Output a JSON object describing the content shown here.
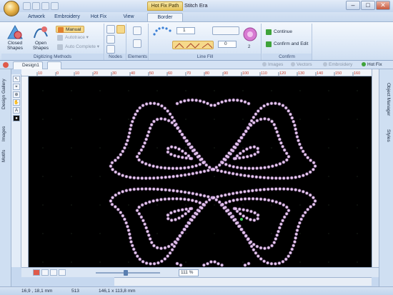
{
  "window": {
    "title": "Stitch Era",
    "context_tab_title": "Hot Fix Path",
    "controls": {
      "minimize": "–",
      "maximize": "□",
      "close": "✕"
    }
  },
  "ribbon_tabs": [
    {
      "label": "Artwork"
    },
    {
      "label": "Embroidery"
    },
    {
      "label": "Hot Fix"
    },
    {
      "label": "View"
    },
    {
      "label": "Border",
      "active": true
    }
  ],
  "groups": {
    "digitizing": {
      "label": "Digitizing Methods",
      "closed_shapes": "Closed\nShapes",
      "open_shapes": "Open\nShapes",
      "manual": "Manual",
      "autotrace": "Autotrace",
      "auto_complete": "Auto Complete"
    },
    "nodes": {
      "label": "Nodes"
    },
    "elements": {
      "label": "Elements"
    },
    "line_fill": {
      "label": "Line Fill",
      "spin1": "1",
      "spin2": "0",
      "count": "2"
    },
    "confirm": {
      "label": "Confirm",
      "continue": "Continue",
      "confirm_edit": "Confirm and Edit"
    }
  },
  "doc_tabs": [
    {
      "label": "Design1"
    },
    {
      "label": ""
    }
  ],
  "filters": [
    {
      "label": "Images",
      "active": false
    },
    {
      "label": "Vectors",
      "active": false
    },
    {
      "label": "Embroidery",
      "active": false
    },
    {
      "label": "Hot Fix",
      "active": true
    }
  ],
  "left_panels": [
    "Design Gallery",
    "Images",
    "Motifs"
  ],
  "right_panels": [
    "Object Manager",
    "Styles"
  ],
  "hruler_ticks": [
    "10",
    "0",
    "10",
    "20",
    "30",
    "40",
    "50",
    "60",
    "70",
    "80",
    "90",
    "100",
    "110",
    "120",
    "130",
    "140",
    "150",
    "160"
  ],
  "zoom": "111 %",
  "status": {
    "coords": "16,9 , 18,1 mm",
    "stones": "513",
    "size": "146,1 x 113,8 mm"
  },
  "colors": {
    "canvas": "#000000",
    "stone": "#e7c8ef",
    "stone_glow": "#b98bd0",
    "accent": "#3a7fd5"
  }
}
